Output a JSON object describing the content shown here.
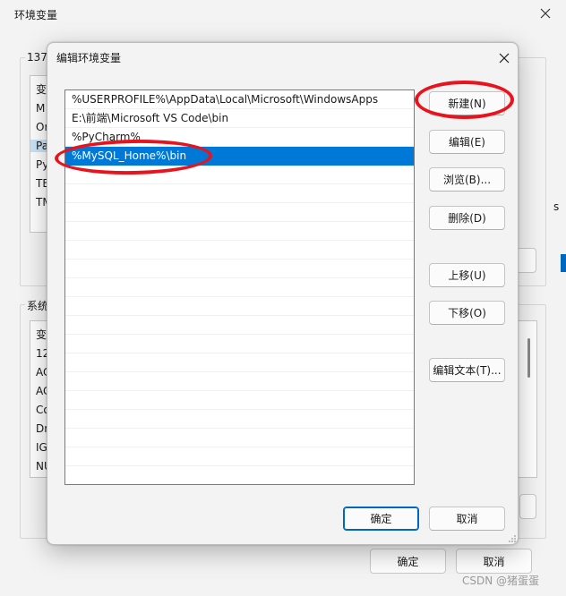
{
  "bg_window": {
    "title": "环境变量",
    "user_group_label": "1370",
    "user_vars_header": "变",
    "user_vars_items": [
      "M",
      "Or",
      "Pa",
      "Py",
      "TE",
      "TM"
    ],
    "system_group_label": "系统",
    "system_vars_header": "变",
    "system_vars_items": [
      "12",
      "AC",
      "AC",
      "Co",
      "Dr",
      "IG",
      "NU"
    ],
    "right_edge_text": "s",
    "ok_label": "确定",
    "cancel_label": "取消",
    "watermark": "CSDN @猪蛋蛋"
  },
  "dialog": {
    "title": "编辑环境变量",
    "paths": [
      "%USERPROFILE%\\AppData\\Local\\Microsoft\\WindowsApps",
      "E:\\前端\\Microsoft VS Code\\bin",
      "%PyCharm%",
      "%MySQL_Home%\\bin"
    ],
    "selected_index": 3,
    "buttons": {
      "new": "新建(N)",
      "edit": "编辑(E)",
      "browse": "浏览(B)...",
      "delete": "删除(D)",
      "move_up": "上移(U)",
      "move_down": "下移(O)",
      "edit_text": "编辑文本(T)..."
    },
    "ok_label": "确定",
    "cancel_label": "取消"
  },
  "colors": {
    "selection": "#0078d7",
    "annotation": "#e8131c",
    "accent": "#0067c0"
  }
}
